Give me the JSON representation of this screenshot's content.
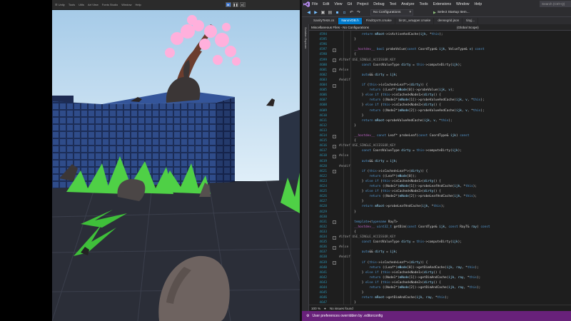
{
  "game": {
    "toolbar_items": [
      "☰ Unity",
      "Tools",
      "Utils",
      "Art View",
      "Fonts Studio",
      "Window",
      "Help"
    ],
    "colors": {
      "sky": "#9fc7e6",
      "wall": "#2f4c8a",
      "floor": "#2b2e38",
      "leaf": "#4fd046",
      "tree": "#ffb0dc",
      "trunk": "#6b3d2e"
    }
  },
  "ide": {
    "menu": [
      "File",
      "Edit",
      "View",
      "Git",
      "Project",
      "Debug",
      "Test",
      "Analyze",
      "Tools",
      "Extensions",
      "Window",
      "Help"
    ],
    "search_placeholder": "Search (Ctrl+Q)",
    "config_dropdown": "No Configurations",
    "startup_button": "Select Startup Item...",
    "tabs": [
      {
        "label": "SanityTests.cs",
        "active": false
      },
      {
        "label": "NanoVDB.h",
        "active": true
      },
      {
        "label": "FindOpVX.cmake",
        "active": false
      },
      {
        "label": "bin2c_wrapper.cmake",
        "active": false
      },
      {
        "label": "densegrid.json",
        "active": false
      },
      {
        "label": "tinyj...",
        "active": false
      }
    ],
    "side_strip_label": "Solution Explorer",
    "nav_left": "Miscellaneous Files - No Configurations",
    "nav_right": "(Global Scope)",
    "zoom": "100 %",
    "issues": "No issues found",
    "status_message": "User preferences overridden by .editorconfig",
    "accent": "#007acc",
    "status_color": "#68217a",
    "code_lines": [
      {
        "n": "4594",
        "text": "            return mRoot->isActiveAndCache(ijk, *this);",
        "fold": ""
      },
      {
        "n": "4595",
        "text": "        }",
        "fold": ""
      },
      {
        "n": "4596",
        "text": "",
        "fold": ""
      },
      {
        "n": "4597",
        "text": "        __hostdev__ bool probeValue(const CoordType& ijk, ValueType& v) const",
        "fold": "-"
      },
      {
        "n": "4598",
        "text": "        {",
        "fold": ""
      },
      {
        "n": "4599",
        "text": "#ifdef USE_SINGLE_ACCESSOR_KEY",
        "fold": "-"
      },
      {
        "n": "4600",
        "text": "            const CoordValueType dirty = this->computeDirty(ijk);",
        "fold": ""
      },
      {
        "n": "4601",
        "text": "#else",
        "fold": "-"
      },
      {
        "n": "4602",
        "text": "            auto&& dirty = ijk;",
        "fold": ""
      },
      {
        "n": "4603",
        "text": "#endif",
        "fold": ""
      },
      {
        "n": "4604",
        "text": "            if (this->isCached<Leaf*>(dirty)) {",
        "fold": "-"
      },
      {
        "n": "4605",
        "text": "                return ((Leaf*)mNode[0])->probeValue(ijk, v);",
        "fold": ""
      },
      {
        "n": "4606",
        "text": "            } else if (this->isCached<Node1>(dirty)) {",
        "fold": ""
      },
      {
        "n": "4607",
        "text": "                return ((Node1*)mNode[1])->probeValueAndCache(ijk, v, *this);",
        "fold": ""
      },
      {
        "n": "4608",
        "text": "            } else if (this->isCached<Node2>(dirty)) {",
        "fold": ""
      },
      {
        "n": "4609",
        "text": "                return ((Node2*)mNode[2])->probeValueAndCache(ijk, v, *this);",
        "fold": ""
      },
      {
        "n": "4610",
        "text": "            }",
        "fold": ""
      },
      {
        "n": "4611",
        "text": "            return mRoot->probeValueAndCache(ijk, v, *this);",
        "fold": ""
      },
      {
        "n": "4612",
        "text": "        }",
        "fold": ""
      },
      {
        "n": "4613",
        "text": "",
        "fold": ""
      },
      {
        "n": "4614",
        "text": "        __hostdev__ const Leaf* probeLeaf(const CoordType& ijk) const",
        "fold": "-"
      },
      {
        "n": "4615",
        "text": "        {",
        "fold": ""
      },
      {
        "n": "4616",
        "text": "#ifdef USE_SINGLE_ACCESSOR_KEY",
        "fold": "-"
      },
      {
        "n": "4617",
        "text": "            const CoordValueType dirty = this->computeDirty(ijk);",
        "fold": ""
      },
      {
        "n": "4618",
        "text": "#else",
        "fold": "-"
      },
      {
        "n": "4619",
        "text": "            auto&& dirty = ijk;",
        "fold": ""
      },
      {
        "n": "4620",
        "text": "#endif",
        "fold": ""
      },
      {
        "n": "4621",
        "text": "            if (this->isCached<Leaf*>(dirty)) {",
        "fold": "-"
      },
      {
        "n": "4622",
        "text": "                return ((Leaf*)mNode[0]);",
        "fold": ""
      },
      {
        "n": "4623",
        "text": "            } else if (this->isCached<Node1>(dirty)) {",
        "fold": ""
      },
      {
        "n": "4624",
        "text": "                return ((Node1*)mNode[1])->probeLeafAndCache(ijk, *this);",
        "fold": ""
      },
      {
        "n": "4625",
        "text": "            } else if (this->isCached<Node2>(dirty)) {",
        "fold": ""
      },
      {
        "n": "4626",
        "text": "                return ((Node2*)mNode[2])->probeLeafAndCache(ijk, *this);",
        "fold": ""
      },
      {
        "n": "4627",
        "text": "            }",
        "fold": ""
      },
      {
        "n": "4628",
        "text": "            return mRoot->probeLeafAndCache(ijk, *this);",
        "fold": ""
      },
      {
        "n": "4629",
        "text": "        }",
        "fold": ""
      },
      {
        "n": "4630",
        "text": "",
        "fold": ""
      },
      {
        "n": "4631",
        "text": "        template<typename RayT>",
        "fold": "-"
      },
      {
        "n": "4632",
        "text": "        __hostdev__ uint32_t getDim(const CoordType& ijk, const RayT& ray) const",
        "fold": ""
      },
      {
        "n": "4633",
        "text": "        {",
        "fold": ""
      },
      {
        "n": "4634",
        "text": "#ifdef USE_SINGLE_ACCESSOR_KEY",
        "fold": "-"
      },
      {
        "n": "4635",
        "text": "            const CoordValueType dirty = this->computeDirty(ijk);",
        "fold": ""
      },
      {
        "n": "4636",
        "text": "#else",
        "fold": "-"
      },
      {
        "n": "4637",
        "text": "            auto&& dirty = ijk;",
        "fold": ""
      },
      {
        "n": "4638",
        "text": "#endif",
        "fold": ""
      },
      {
        "n": "4639",
        "text": "            if (this->isCached<Leaf*>(dirty)) {",
        "fold": "-"
      },
      {
        "n": "4640",
        "text": "                return ((Leaf*)mNode[0])->getDimAndCache(ijk, ray, *this);",
        "fold": ""
      },
      {
        "n": "4641",
        "text": "            } else if (this->isCached<Node1>(dirty)) {",
        "fold": ""
      },
      {
        "n": "4642",
        "text": "                return ((Node1*)mNode[1])->getDimAndCache(ijk, ray, *this);",
        "fold": ""
      },
      {
        "n": "4643",
        "text": "            } else if (this->isCached<Node2>(dirty)) {",
        "fold": ""
      },
      {
        "n": "4644",
        "text": "                return ((Node2*)mNode[2])->getDimAndCache(ijk, ray, *this);",
        "fold": ""
      },
      {
        "n": "4645",
        "text": "            }",
        "fold": ""
      },
      {
        "n": "4646",
        "text": "            return mRoot->getDimAndCache(ijk, ray, *this);",
        "fold": ""
      },
      {
        "n": "4647",
        "text": "        }",
        "fold": ""
      }
    ]
  }
}
